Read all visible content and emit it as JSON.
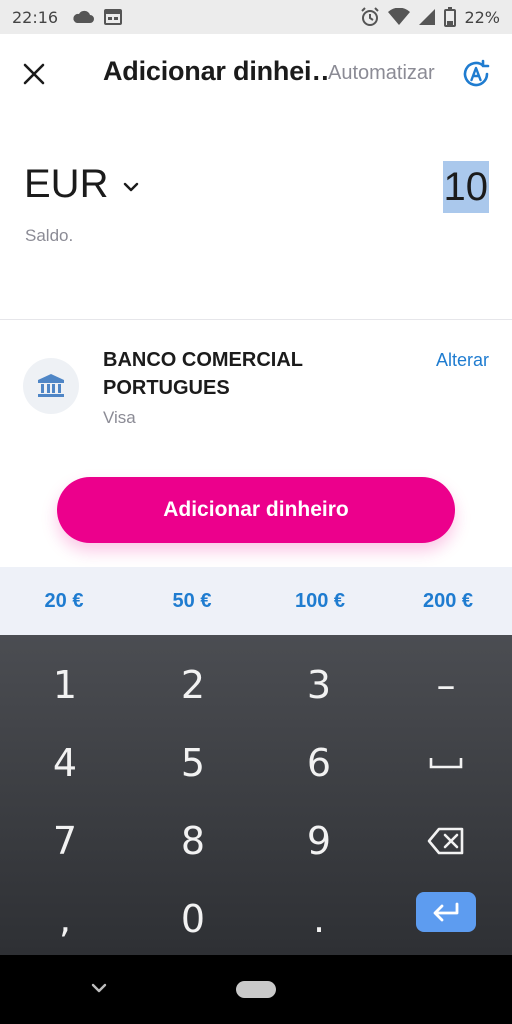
{
  "status_bar": {
    "time": "22:16",
    "battery": "22%"
  },
  "header": {
    "title": "Adicionar dinhei…",
    "automate_label": "Automatizar"
  },
  "amount": {
    "currency": "EUR",
    "value": "10",
    "balance_label": "Saldo."
  },
  "bank": {
    "name": "BANCO COMERCIAL PORTUGUES",
    "method": "Visa",
    "change_label": "Alterar"
  },
  "cta": {
    "label": "Adicionar dinheiro"
  },
  "quick_amounts": [
    "20 €",
    "50 €",
    "100 €",
    "200 €"
  ],
  "keypad": {
    "k1": "1",
    "k2": "2",
    "k3": "3",
    "minus": "–",
    "k4": "4",
    "k5": "5",
    "k6": "6",
    "k7": "7",
    "k8": "8",
    "k9": "9",
    "comma": ",",
    "k0": "0",
    "dot": "."
  },
  "colors": {
    "accent": "#ec008c",
    "link": "#1f7cd0",
    "selection": "#aac8ec",
    "enter_key": "#5d9cf0"
  },
  "icons": [
    "cloud-icon",
    "calendar-icon",
    "alarm-icon",
    "wifi-icon",
    "signal-icon",
    "battery-icon",
    "close-icon",
    "automate-icon",
    "chevron-down-icon",
    "bank-icon",
    "space-icon",
    "backspace-icon",
    "enter-icon",
    "nav-back-icon"
  ]
}
